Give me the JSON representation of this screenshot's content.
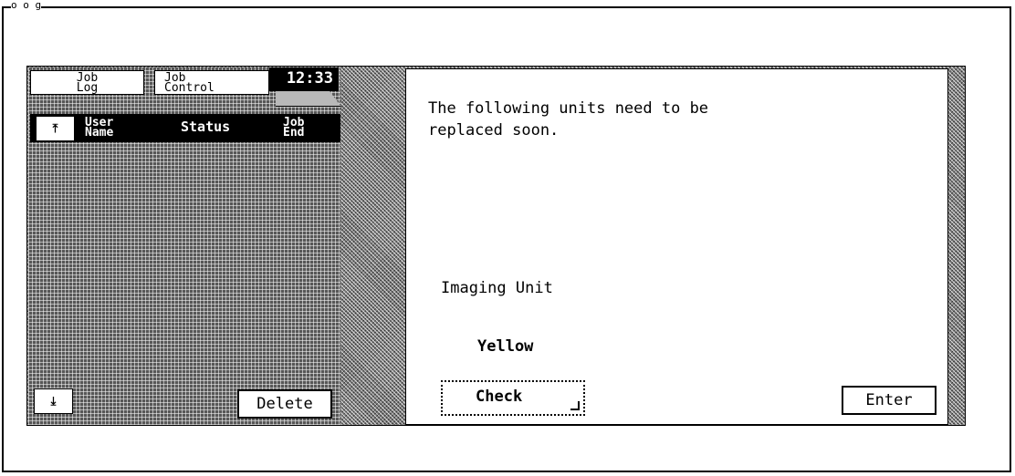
{
  "caption": "o o g",
  "left_panel": {
    "tabs": {
      "job_log": "Job\nLog",
      "job_control": "Job\nControl"
    },
    "time": "12:33",
    "columns": {
      "user_name": "User\nName",
      "status": "Status",
      "job_end": "Job\nEnd"
    },
    "scroll_up_icon": "⤒",
    "scroll_down_icon": "⤓",
    "delete_label": "Delete"
  },
  "dialog": {
    "message": "The following units need to be\nreplaced soon.",
    "unit_name": "Imaging Unit",
    "unit_color": "Yellow",
    "check_label": "Check",
    "enter_label": "Enter"
  }
}
